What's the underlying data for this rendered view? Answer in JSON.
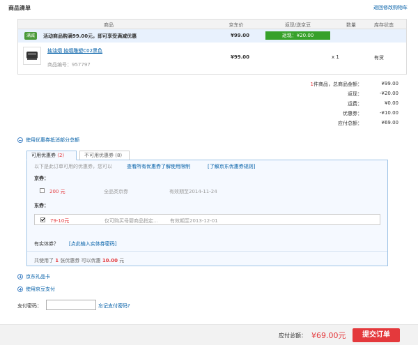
{
  "header": {
    "title": "商品清单",
    "back_link": "返回修改购物车"
  },
  "table": {
    "columns": [
      "商品",
      "京东价",
      "返现/送京豆",
      "数量",
      "库存状态"
    ],
    "promo": {
      "badge": "满减",
      "text": "活动商品购满99.00元，即可享受满减优惠",
      "price": "¥99.00",
      "cashback": "返现：¥20.00"
    },
    "item": {
      "name": "抽油烟 抽烟雕塑C02黑色",
      "code": "商品编号：957797",
      "price": "¥99.00",
      "qty": "x 1",
      "stock": "有货"
    }
  },
  "summary": [
    {
      "label_prefix": "1",
      "label": "件商品，总商品金额：",
      "value": "¥99.00"
    },
    {
      "label_prefix": "",
      "label": "返现：",
      "value": "-¥20.00"
    },
    {
      "label_prefix": "",
      "label": "运费：",
      "value": "¥0.00"
    },
    {
      "label_prefix": "",
      "label": "优惠券：",
      "value": "-¥10.00"
    },
    {
      "label_prefix": "",
      "label": "应付总额：",
      "value": "¥69.00"
    }
  ],
  "coupon_toggle": "使用优惠券抵消部分总额",
  "coupon": {
    "tab_available": "可用优惠券",
    "tab_available_count": "(2)",
    "tab_unavailable": "不可用优惠券",
    "tab_unavailable_count": "(8)",
    "info": "以下是此订单可用的优惠券，您可以",
    "link_view_all": "查看所有优惠券了解使用限制",
    "link_rules": "[了解京东优惠券规则]",
    "group_jing": "京券：",
    "group_dong": "东券：",
    "jing_amount": "200",
    "jing_unit": "元",
    "jing_desc": "全品类京券",
    "jing_expire": "有效期至2014-11-24",
    "dong_amount": "79-10",
    "dong_unit": "元",
    "dong_desc": "仅可购买母婴商品指定...",
    "dong_expire": "有效期至2013-12-01",
    "entity_label": "有实体券？",
    "entity_link": "[点此输入实体券密码]",
    "footer_pre": "共使用了",
    "footer_count": "1",
    "footer_mid": "张优惠券   可以优惠",
    "footer_amount": "10.00",
    "footer_post": "元"
  },
  "gift_card": "京东礼品卡",
  "jingdou": "使用京豆支付",
  "pay_password": {
    "label": "支付密码：",
    "value": "",
    "forgot": "忘记支付密码?"
  },
  "bottom": {
    "total_label": "应付总额：",
    "total_value": "¥69.00元",
    "submit": "提交订单"
  }
}
